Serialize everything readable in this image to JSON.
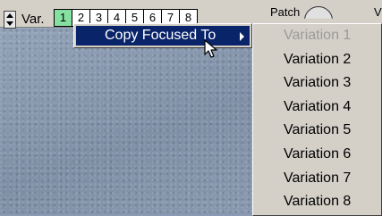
{
  "toolbar": {
    "var_label": "Var.",
    "variation_buttons": [
      "1",
      "2",
      "3",
      "4",
      "5",
      "6",
      "7",
      "8"
    ],
    "active_variation": "1",
    "patch_label": "Patch",
    "v_label": "V"
  },
  "context_menu": {
    "item_label": "Copy Focused To",
    "item_icon": "chevron-right-icon"
  },
  "submenu": {
    "items": [
      {
        "label": "Variation 1",
        "disabled": true
      },
      {
        "label": "Variation 2",
        "disabled": false
      },
      {
        "label": "Variation 3",
        "disabled": false
      },
      {
        "label": "Variation 4",
        "disabled": false
      },
      {
        "label": "Variation 5",
        "disabled": false
      },
      {
        "label": "Variation 6",
        "disabled": false
      },
      {
        "label": "Variation 7",
        "disabled": false
      },
      {
        "label": "Variation 8",
        "disabled": false
      }
    ]
  },
  "colors": {
    "menu_highlight": "#0a246a",
    "menu_background": "#d4d0c8",
    "active_variation": "#86e0a0",
    "disabled_text": "#9a9a9a"
  }
}
